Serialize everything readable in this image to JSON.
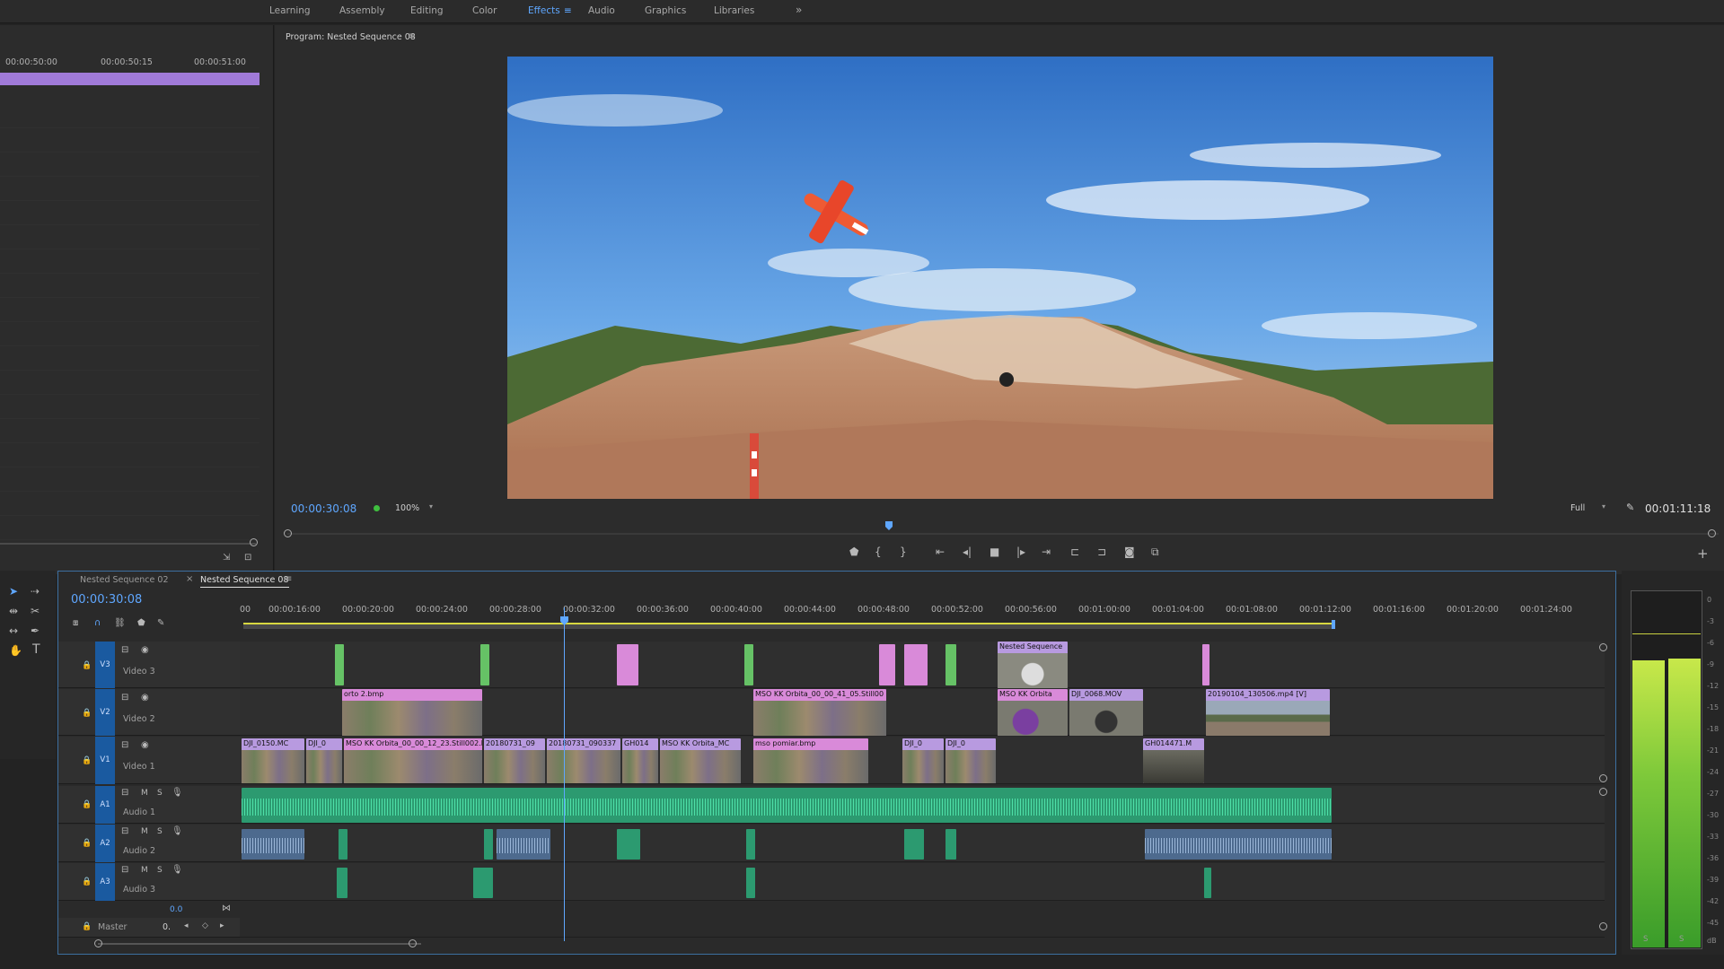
{
  "workspaces": {
    "tabs": [
      "Learning",
      "Assembly",
      "Editing",
      "Color",
      "Effects",
      "Audio",
      "Graphics",
      "Libraries"
    ],
    "active": "Effects",
    "overflow": "»"
  },
  "source": {
    "ruler": [
      "00:00:50:00",
      "00:00:50:15",
      "00:00:51:00"
    ]
  },
  "program": {
    "title": "Program: Nested Sequence 08",
    "menu": "≡",
    "timecode": "00:00:30:08",
    "zoom": "100%",
    "resolution": "Full",
    "duration": "00:01:11:18"
  },
  "timeline": {
    "tabs": [
      "Nested Sequence 02",
      "Nested Sequence 08"
    ],
    "active_tab": "Nested Sequence 08",
    "close_glyph": "×",
    "menu": "≡",
    "timecode": "00:00:30:08",
    "ruler": [
      "00",
      "00:00:16:00",
      "00:00:20:00",
      "00:00:24:00",
      "00:00:28:00",
      "00:00:32:00",
      "00:00:36:00",
      "00:00:40:00",
      "00:00:44:00",
      "00:00:48:00",
      "00:00:52:00",
      "00:00:56:00",
      "00:01:00:00",
      "00:01:04:00",
      "00:01:08:00",
      "00:01:12:00",
      "00:01:16:00",
      "00:01:20:00",
      "00:01:24:00"
    ],
    "tracks": {
      "v3": {
        "badge": "V3",
        "name": "Video 3"
      },
      "v2": {
        "badge": "V2",
        "name": "Video 2"
      },
      "v1": {
        "badge": "V1",
        "name": "Video 1"
      },
      "a1": {
        "badge": "A1",
        "name": "Audio 1"
      },
      "a2": {
        "badge": "A2",
        "name": "Audio 2"
      },
      "a3": {
        "badge": "A3",
        "name": "Audio 3"
      }
    },
    "master": {
      "name": "Master",
      "value": "0.",
      "level": "0.0"
    },
    "mute_label": "M",
    "solo_label": "S",
    "clips": {
      "v3_nested": "Nested Sequence",
      "v2_orto": "orto 2.bmp",
      "v2_mso": "MSO KK Orbita_00_00_41_05.Still00",
      "v2_mso2": "MSO KK Orbita",
      "v2_dji": "DJI_0068.MOV",
      "v2_2019": "20190104_130506.mp4 [V]",
      "v1_dji0150": "DJI_0150.MC",
      "v1_dji": "DJI_0",
      "v1_mso": "MSO KK Orbita_00_00_12_23.Still002.b",
      "v1_2018a": "20180731_09",
      "v1_2018b": "20180731_090337",
      "v1_gh": "GH014",
      "v1_mso2": "MSO KK Orbita_MC",
      "v1_mapa": "mso pomiar.bmp",
      "v1_dji2": "DJI_0",
      "v1_dji3": "DJI_0",
      "v1_gh2": "GH014471.M"
    }
  },
  "meters": {
    "scale": [
      "0",
      "-3",
      "-6",
      "-9",
      "-12",
      "-15",
      "-18",
      "-21",
      "-24",
      "-27",
      "-30",
      "-33",
      "-36",
      "-39",
      "-42",
      "-45",
      "dB"
    ],
    "solo": [
      "S",
      "S"
    ],
    "left_level_db": -9,
    "right_level_db": -9
  },
  "colors": {
    "accent": "#5fa7ff",
    "timecode": "#5fa7ff",
    "video_pink": "#d98ad9",
    "video_green": "#66c266",
    "audio_green": "#2c9a70",
    "track_badge": "#1a5aa0",
    "meter_green": "#7ec93a"
  }
}
